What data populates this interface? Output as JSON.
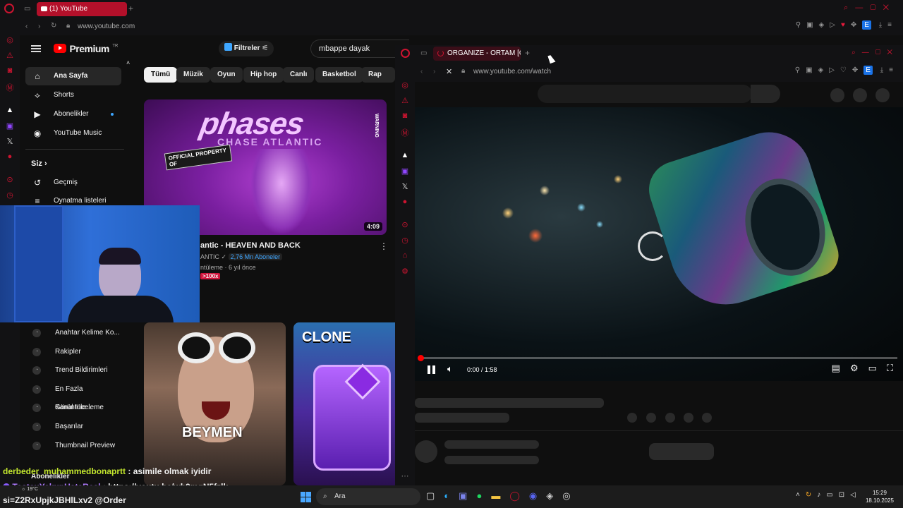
{
  "browser": {
    "tab_title": "(1) YouTube",
    "url": "www.youtube.com",
    "new_tab": "+"
  },
  "youtube": {
    "logo": "Premium",
    "logo_region": "TR",
    "filters_label": "Filtreler",
    "search_value": "mbappe dayak",
    "nav": [
      {
        "label": "Ana Sayfa",
        "icon": "home-icon"
      },
      {
        "label": "Shorts",
        "icon": "shorts-icon"
      },
      {
        "label": "Abonelikler",
        "icon": "subscriptions-icon"
      },
      {
        "label": "YouTube Music",
        "icon": "music-icon"
      }
    ],
    "you_section": "Siz",
    "you_items": [
      {
        "label": "Geçmiş",
        "icon": "history-icon"
      },
      {
        "label": "Oynatma listeleri",
        "icon": "playlist-icon"
      }
    ],
    "ext_items": [
      "Anahtar Kelime Ko...",
      "Rakipler",
      "Trend Bildirimleri",
      "En Fazla Görüntüle...",
      "Kanal Inceleme",
      "Başarılar",
      "Thumbnail Preview"
    ],
    "subscriptions_footer": "Abonelikler",
    "chips": [
      "Tümü",
      "Müzik",
      "Oyun",
      "Hip hop",
      "Canlı",
      "Basketbol",
      "Rap yapm"
    ],
    "video1": {
      "thumb_title": "phases",
      "thumb_sub": "CHASE ATLANTIC",
      "thumb_badge": "OFFICIAL PROPERTY OF",
      "warning": "WARNING",
      "duration": "4:09",
      "title": "antic - HEAVEN AND BACK",
      "channel": "ANTIC",
      "subs_badge": "2,76 Mn Aboneler",
      "meta": "ntüleme · 6 yıl önce",
      "badge": ">100x"
    },
    "short1_text": "BEYMEN",
    "short2_text": "CLONE"
  },
  "window2": {
    "tab_title": "ORGANIZE - ORTAM [OFF",
    "url": "www.youtube.com/watch",
    "time": "0:00 / 1:58"
  },
  "chat": [
    {
      "user": "derbeder_muhammedbonaprtt",
      "sep": " : ",
      "msg": "asimile olmak iyidir",
      "color": "#c3e62e"
    },
    {
      "user": "TostcuYakupUstaReal",
      "sep": " : ",
      "msg": "https://youtu.be/wh9mqN5fzlk",
      "color": "#b07bff"
    },
    {
      "user": "",
      "sep": "",
      "msg": "si=Z2RxUpjkJBHlLxv2 @Order",
      "color": "#ffffff"
    }
  ],
  "taskbar": {
    "search": "Ara",
    "weather": "19°C",
    "time": "15:29",
    "date": "18.10.2025"
  },
  "colors": {
    "opera_red": "#cc1430",
    "yt_red": "#ff0000",
    "bg": "#0f0f0f"
  }
}
